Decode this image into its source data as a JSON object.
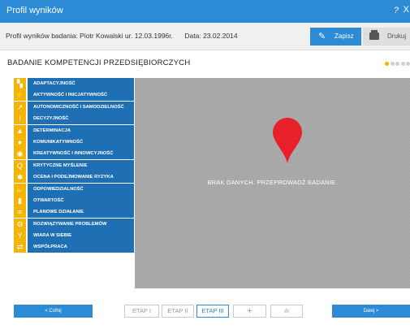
{
  "window": {
    "title": "Profil wyników",
    "help": "?",
    "close": "X"
  },
  "infobar": {
    "profile_text": "Profil wyników badania: Piotr Kowalski ur. 12.03.1996r.",
    "date_text": "Data: 23.02.2014",
    "save_label": "Zapisz",
    "print_label": "Drukuj"
  },
  "heading": "BADANIE KOMPETENCJI PRZEDSIĘBIORCZYCH",
  "progress": {
    "total": 5,
    "current": 1,
    "active_color": "#f5b400"
  },
  "competencies": [
    {
      "label": "ADAPTACYJNOŚĆ",
      "icon": "jigsaw-icon",
      "glyph": "▚"
    },
    {
      "label": "AKTYWNOŚĆ I INICJATYWNOŚĆ",
      "icon": "runner-icon",
      "glyph": "⚡"
    },
    {
      "label": "AUTONOMICZNOŚĆ I SAMODZIELNOŚĆ",
      "icon": "climber-icon",
      "glyph": "↗"
    },
    {
      "label": "DECYZYJNOŚĆ",
      "icon": "exclamation-icon",
      "glyph": "!"
    },
    {
      "label": "DETERMINACJA",
      "icon": "mountain-icon",
      "glyph": "▲"
    },
    {
      "label": "KOMUNIKATYWNOŚĆ",
      "icon": "speech-bubble-icon",
      "glyph": "●"
    },
    {
      "label": "KREATYWNOŚĆ I INNOWCYJNOŚĆ",
      "icon": "lightbulb-icon",
      "glyph": "◉"
    },
    {
      "label": "KRYTYCZNE MYŚLENIE",
      "icon": "magnifier-icon",
      "glyph": "Q"
    },
    {
      "label": "OCENA I PODEJMOWANIE RYZYKA",
      "icon": "acrobat-icon",
      "glyph": "✱"
    },
    {
      "label": "ODPOWIEDZIALNOŚĆ",
      "icon": "hand-icon",
      "glyph": "✋"
    },
    {
      "label": "OTWARTOŚĆ",
      "icon": "door-icon",
      "glyph": "▮"
    },
    {
      "label": "PLANOWE DZIAŁANIE",
      "icon": "checklist-icon",
      "glyph": "≡"
    },
    {
      "label": "ROZWIĄZYWANIE PROBLEMÓW",
      "icon": "gears-icon",
      "glyph": "⚙"
    },
    {
      "label": "WIARA W SIEBIE",
      "icon": "person-arms-up-icon",
      "glyph": "Y"
    },
    {
      "label": "WSPÓŁPRACA",
      "icon": "handshake-icon",
      "glyph": "⇄"
    }
  ],
  "panel": {
    "message": "BRAK DANYCH. PRZEPROWADŹ BADANIE.",
    "pin_color": "#e8202a"
  },
  "footer": {
    "back_label": "<  Cofnij",
    "next_label": "Dalej  >",
    "stages": [
      "ETAP I",
      "ETAP II",
      "ETAP III"
    ],
    "add_label": "+",
    "chart_label": "ılı"
  }
}
